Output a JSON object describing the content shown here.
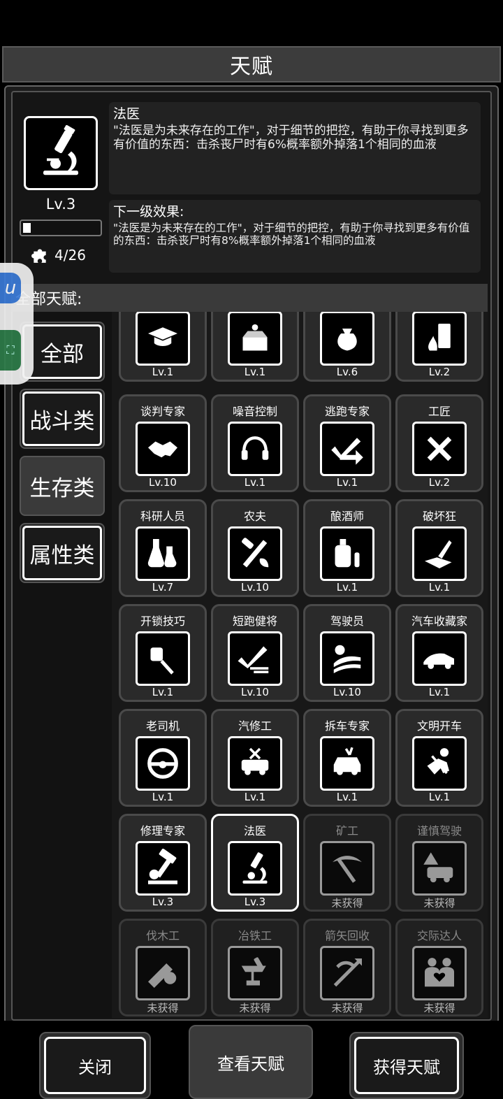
{
  "header": {
    "title": "天赋"
  },
  "selected": {
    "name": "法医",
    "level": "Lv.3",
    "description": "\"法医是为未来存在的工作\"，对于细节的把控，有助于你寻找到更多有价值的东西：击杀丧尸时有6%概率额外掉落1个相同的血液",
    "next_label": "下一级效果:",
    "next_description": "\"法医是为未来存在的工作\"，对于细节的把控，有助于你寻找到更多有价值的东西：击杀丧尸时有8%概率额外掉落1个相同的血液",
    "progress": 0.1,
    "points": "4/26",
    "icon": "microscope-icon"
  },
  "all_label": "全部天赋:",
  "categories": [
    {
      "label": "全部",
      "selected": false
    },
    {
      "label": "战斗类",
      "selected": false
    },
    {
      "label": "生存类",
      "selected": true
    },
    {
      "label": "属性类",
      "selected": false
    }
  ],
  "talents": [
    {
      "name": "",
      "level": "Lv.1",
      "icon": "graduation-cap-icon",
      "locked": false
    },
    {
      "name": "",
      "level": "Lv.1",
      "icon": "box-icon",
      "locked": false
    },
    {
      "name": "",
      "level": "Lv.6",
      "icon": "sack-icon",
      "locked": false
    },
    {
      "name": "",
      "level": "Lv.2",
      "icon": "door-fire-icon",
      "locked": false
    },
    {
      "name": "谈判专家",
      "level": "Lv.10",
      "icon": "handshake-icon",
      "locked": false
    },
    {
      "name": "噪音控制",
      "level": "Lv.1",
      "icon": "headphones-icon",
      "locked": false
    },
    {
      "name": "逃跑专家",
      "level": "Lv.1",
      "icon": "escape-arrow-icon",
      "locked": false
    },
    {
      "name": "工匠",
      "level": "Lv.2",
      "icon": "hammer-saw-icon",
      "locked": false
    },
    {
      "name": "科研人员",
      "level": "Lv.7",
      "icon": "flask-icon",
      "locked": false
    },
    {
      "name": "农夫",
      "level": "Lv.10",
      "icon": "tools-leaf-icon",
      "locked": false
    },
    {
      "name": "酿酒师",
      "level": "Lv.1",
      "icon": "brewing-tank-icon",
      "locked": false
    },
    {
      "name": "破坏狂",
      "level": "Lv.1",
      "icon": "smash-icon",
      "locked": false
    },
    {
      "name": "开锁技巧",
      "level": "Lv.1",
      "icon": "lockpick-icon",
      "locked": false
    },
    {
      "name": "短跑健将",
      "level": "Lv.10",
      "icon": "sprint-check-icon",
      "locked": false
    },
    {
      "name": "驾驶员",
      "level": "Lv.10",
      "icon": "driver-icon",
      "locked": false
    },
    {
      "name": "汽车收藏家",
      "level": "Lv.1",
      "icon": "sports-car-icon",
      "locked": false
    },
    {
      "name": "老司机",
      "level": "Lv.1",
      "icon": "steering-wheel-icon",
      "locked": false
    },
    {
      "name": "汽修工",
      "level": "Lv.1",
      "icon": "car-repair-icon",
      "locked": false
    },
    {
      "name": "拆车专家",
      "level": "Lv.1",
      "icon": "car-dismantle-icon",
      "locked": false
    },
    {
      "name": "文明开车",
      "level": "Lv.1",
      "icon": "seatbelt-icon",
      "locked": false
    },
    {
      "name": "修理专家",
      "level": "Lv.3",
      "icon": "hammer-gear-icon",
      "locked": false
    },
    {
      "name": "法医",
      "level": "Lv.3",
      "icon": "microscope-icon",
      "locked": false,
      "current": true
    },
    {
      "name": "矿工",
      "level": "未获得",
      "icon": "pickaxe-icon",
      "locked": true
    },
    {
      "name": "谨慎驾驶",
      "level": "未获得",
      "icon": "car-warning-icon",
      "locked": true
    },
    {
      "name": "伐木工",
      "level": "未获得",
      "icon": "chainsaw-icon",
      "locked": true
    },
    {
      "name": "冶铁工",
      "level": "未获得",
      "icon": "anvil-icon",
      "locked": true
    },
    {
      "name": "箭矢回收",
      "level": "未获得",
      "icon": "arrow-recycle-icon",
      "locked": true
    },
    {
      "name": "交际达人",
      "level": "未获得",
      "icon": "couple-heart-icon",
      "locked": true
    }
  ],
  "buttons": {
    "close": "关闭",
    "view": "查看天赋",
    "get": "获得天赋"
  },
  "colors": {
    "background": "#000000",
    "panel": "#1c1c1c",
    "card": "#2a2a2a",
    "locked_text": "#8a8a8a"
  }
}
